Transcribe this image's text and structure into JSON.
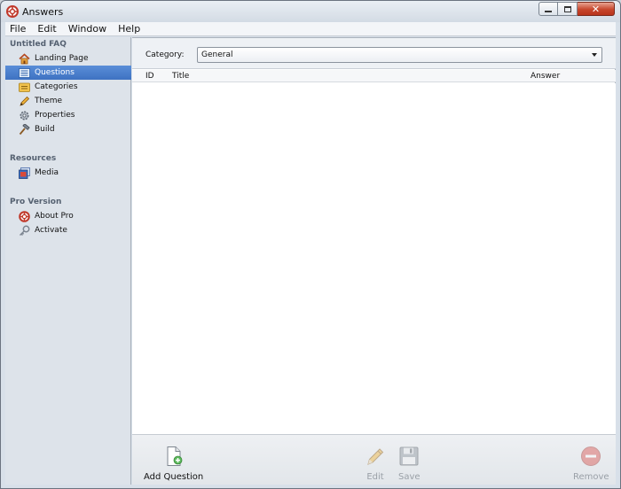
{
  "window": {
    "title": "Answers"
  },
  "menu": [
    "File",
    "Edit",
    "Window",
    "Help"
  ],
  "sidebar": {
    "sections": [
      {
        "title": "Untitled FAQ",
        "items": [
          {
            "label": "Landing Page",
            "icon": "home-icon",
            "selected": false
          },
          {
            "label": "Questions",
            "icon": "list-icon",
            "selected": true
          },
          {
            "label": "Categories",
            "icon": "folder-icon",
            "selected": false
          },
          {
            "label": "Theme",
            "icon": "pencil-icon",
            "selected": false
          },
          {
            "label": "Properties",
            "icon": "gear-icon",
            "selected": false
          },
          {
            "label": "Build",
            "icon": "hammer-icon",
            "selected": false
          }
        ]
      },
      {
        "title": "Resources",
        "items": [
          {
            "label": "Media",
            "icon": "media-icon",
            "selected": false
          }
        ]
      },
      {
        "title": "Pro Version",
        "items": [
          {
            "label": "About Pro",
            "icon": "lifebuoy-icon",
            "selected": false
          },
          {
            "label": "Activate",
            "icon": "key-icon",
            "selected": false
          }
        ]
      }
    ]
  },
  "category": {
    "label": "Category:",
    "selected": "General"
  },
  "table": {
    "columns": [
      "ID",
      "Title",
      "Answer"
    ],
    "rows": []
  },
  "toolbar": {
    "add_question": "Add Question",
    "edit": "Edit",
    "save": "Save",
    "remove": "Remove"
  },
  "colors": {
    "selection": "#3e72c2",
    "remove": "#d9534f",
    "add": "#5cb85c"
  }
}
